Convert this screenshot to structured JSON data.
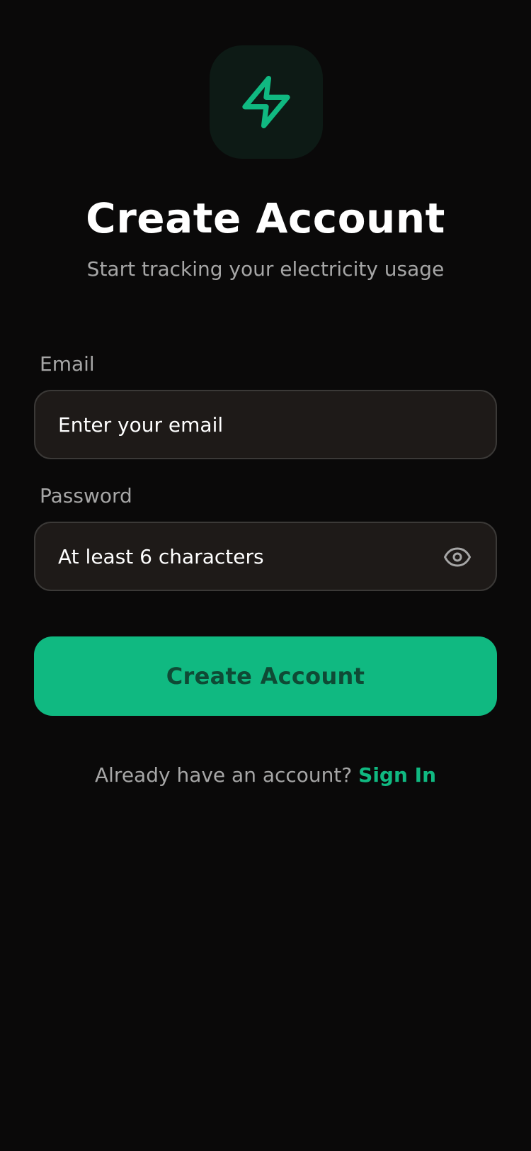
{
  "colors": {
    "background": "#0a0909",
    "accent": "#10b981",
    "logo_tile": "#0d1a15",
    "input_background": "#1e1a18",
    "input_border": "#3b3937",
    "muted_text": "#a6a6a6",
    "button_text": "#0f4a35"
  },
  "logo": {
    "icon": "lightning-bolt-icon"
  },
  "header": {
    "title": "Create Account",
    "subtitle": "Start tracking your electricity usage"
  },
  "form": {
    "email": {
      "label": "Email",
      "placeholder": "Enter your email",
      "value": ""
    },
    "password": {
      "label": "Password",
      "placeholder": "At least 6 characters",
      "value": "",
      "toggle_icon": "eye-icon"
    },
    "submit_label": "Create Account"
  },
  "footer": {
    "prompt": "Already have an account?",
    "link_label": "Sign In"
  }
}
